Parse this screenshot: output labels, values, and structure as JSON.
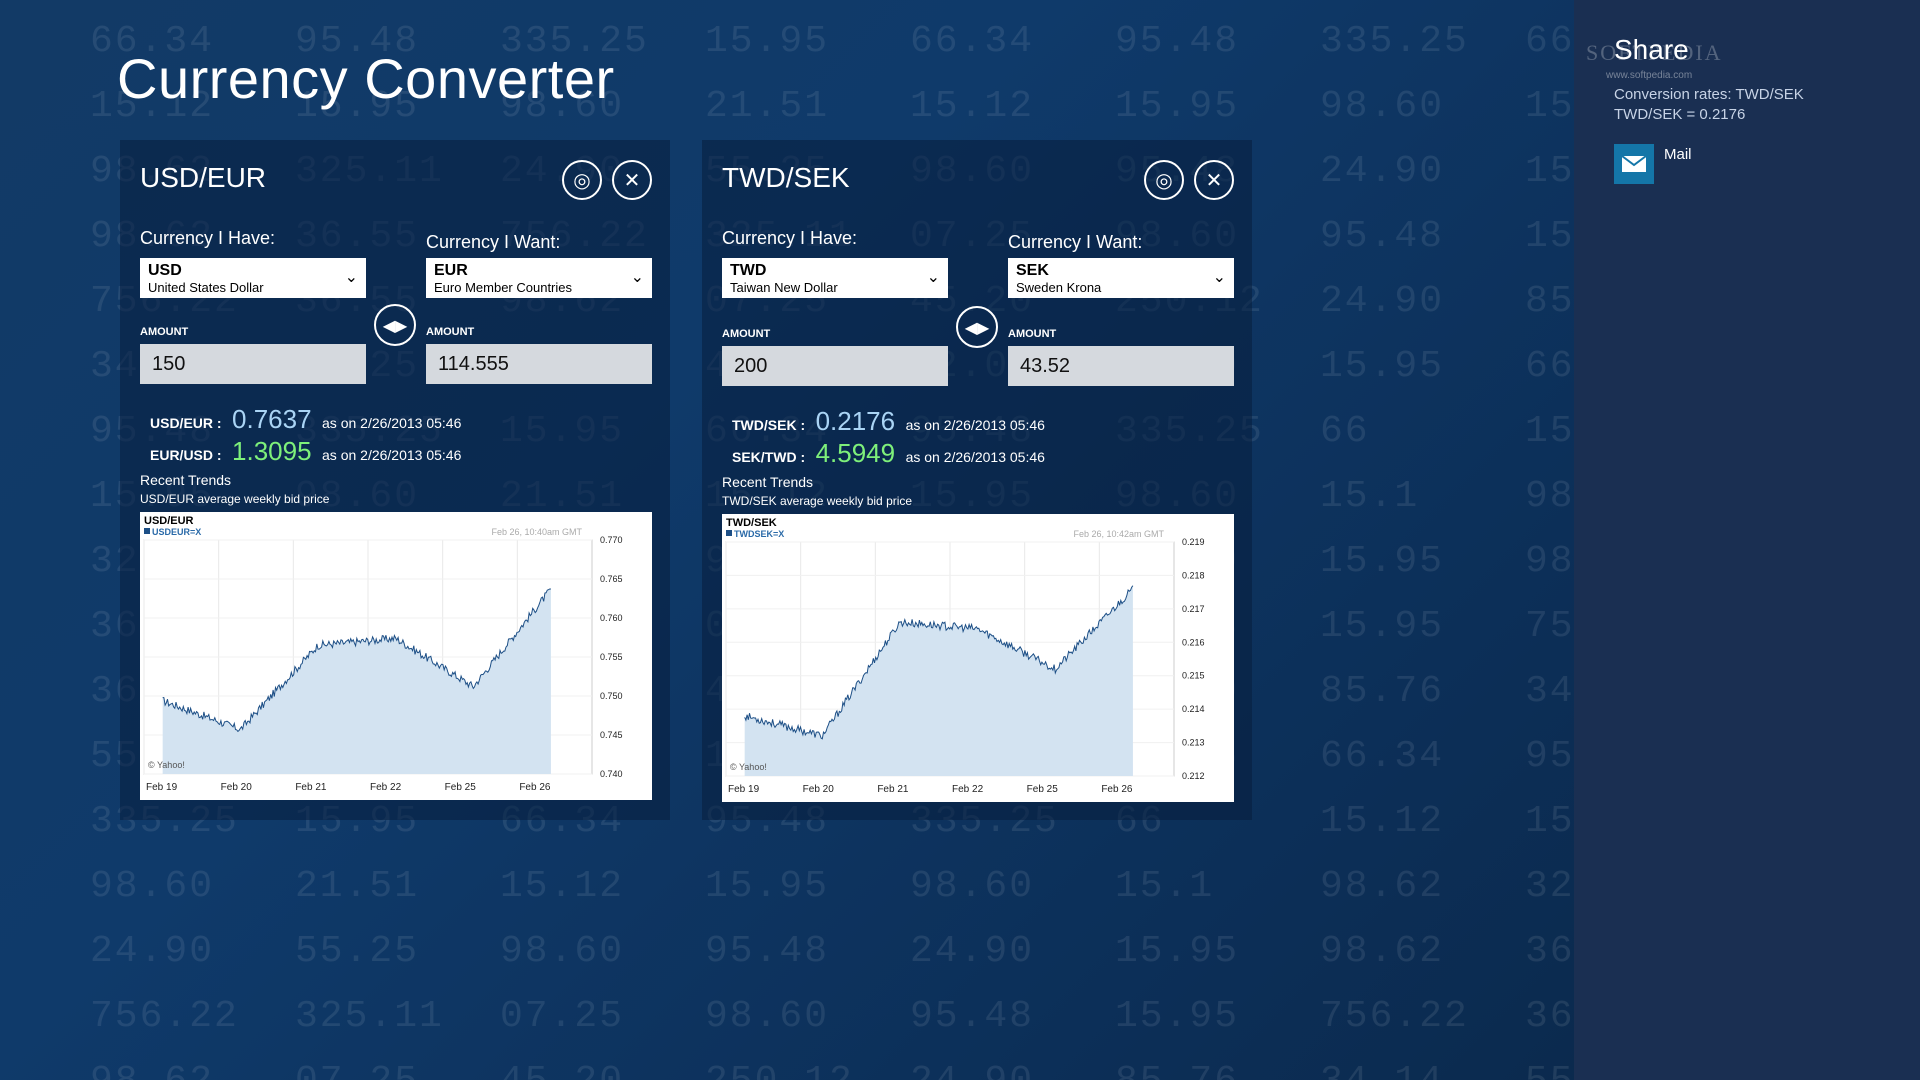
{
  "app": {
    "title": "Currency Converter"
  },
  "background_numbers": [
    "66.34",
    "95.48",
    "335.25",
    "15.95",
    "66.34",
    "95.48",
    "335.25",
    "66",
    "15.12",
    "15.95",
    "98.60",
    "21.51",
    "15.12",
    "15.95",
    "98.60",
    "15.1",
    "98.62",
    "325.11",
    "24.90",
    "55.25",
    "98.60",
    "95.48",
    "24.90",
    "15.95",
    "98.62",
    "36.55",
    "756.22",
    "325.11",
    "07.25",
    "98.60",
    "95.48",
    "15.95",
    "756.22",
    "36.55",
    "98.62",
    "07.25",
    "45.20",
    "250.12",
    "24.90",
    "85.76",
    "34.14",
    "55.25",
    "95.48",
    "47.20",
    "12.04",
    "98.60",
    "15.95"
  ],
  "panels": [
    {
      "pair_title": "USD/EUR",
      "have_label": "Currency I Have:",
      "want_label": "Currency I Want:",
      "have": {
        "code": "USD",
        "name": "United States Dollar"
      },
      "want": {
        "code": "EUR",
        "name": "Euro Member Countries"
      },
      "amount_label": "AMOUNT",
      "amount_have": "150",
      "amount_want": "114.555",
      "rate1": {
        "pair": "USD/EUR",
        "value": "0.7637",
        "asof": "as on  2/26/2013 05:46"
      },
      "rate2": {
        "pair": "EUR/USD",
        "value": "1.3095",
        "asof": "as on  2/26/2013 05:46"
      },
      "trends_title": "Recent Trends",
      "trends_sub": "USD/EUR average weekly bid price",
      "chart": {
        "title": "USD/EUR",
        "legend": "USDEUR=X",
        "timestamp": "Feb 26, 10:40am GMT",
        "credit": "© Yahoo!",
        "x_labels": [
          "Feb 19",
          "Feb 20",
          "Feb 21",
          "Feb 22",
          "Feb 25",
          "Feb 26"
        ],
        "y_labels": [
          "0.770",
          "0.765",
          "0.760",
          "0.755",
          "0.750",
          "0.745",
          "0.740"
        ]
      }
    },
    {
      "pair_title": "TWD/SEK",
      "have_label": "Currency I Have:",
      "want_label": "Currency I Want:",
      "have": {
        "code": "TWD",
        "name": "Taiwan New Dollar"
      },
      "want": {
        "code": "SEK",
        "name": "Sweden Krona"
      },
      "amount_label": "AMOUNT",
      "amount_have": "200",
      "amount_want": "43.52",
      "rate1": {
        "pair": "TWD/SEK",
        "value": "0.2176",
        "asof": "as on  2/26/2013 05:46"
      },
      "rate2": {
        "pair": "SEK/TWD",
        "value": "4.5949",
        "asof": "as on  2/26/2013 05:46"
      },
      "trends_title": "Recent Trends",
      "trends_sub": "TWD/SEK average weekly bid price",
      "chart": {
        "title": "TWD/SEK",
        "legend": "TWDSEK=X",
        "timestamp": "Feb 26, 10:42am GMT",
        "credit": "© Yahoo!",
        "x_labels": [
          "Feb 19",
          "Feb 20",
          "Feb 21",
          "Feb 22",
          "Feb 25",
          "Feb 26"
        ],
        "y_labels": [
          "0.219",
          "0.218",
          "0.217",
          "0.216",
          "0.215",
          "0.214",
          "0.213",
          "0.212"
        ]
      }
    }
  ],
  "chart_data": [
    {
      "type": "area",
      "title": "USD/EUR",
      "series": [
        {
          "name": "USDEUR=X",
          "x": [
            "Feb 19",
            "Feb 20",
            "Feb 21",
            "Feb 22",
            "Feb 25",
            "Feb 26"
          ],
          "values": [
            0.7494,
            0.7457,
            0.7565,
            0.7574,
            0.7512,
            0.7637
          ]
        }
      ],
      "ylim": [
        0.74,
        0.77
      ],
      "y_ticks": [
        0.74,
        0.745,
        0.75,
        0.755,
        0.76,
        0.765,
        0.77
      ],
      "line_color": "#1d4f86",
      "fill_color": "#d3e3f1"
    },
    {
      "type": "area",
      "title": "TWD/SEK",
      "series": [
        {
          "name": "TWDSEK=X",
          "x": [
            "Feb 19",
            "Feb 20",
            "Feb 21",
            "Feb 22",
            "Feb 25",
            "Feb 26"
          ],
          "values": [
            0.2138,
            0.2132,
            0.2166,
            0.2164,
            0.2152,
            0.2176
          ]
        }
      ],
      "ylim": [
        0.212,
        0.219
      ],
      "y_ticks": [
        0.212,
        0.213,
        0.214,
        0.215,
        0.216,
        0.217,
        0.218,
        0.219
      ],
      "line_color": "#1d4f86",
      "fill_color": "#d3e3f1"
    }
  ],
  "share": {
    "title": "Share",
    "line1": "Conversion rates: TWD/SEK",
    "line2": "TWD/SEK = 0.2176",
    "mail_label": "Mail",
    "watermark": "SOFTPEDIA",
    "watermark_url": "www.softpedia.com"
  },
  "icons": {
    "pin": "pin-icon",
    "close": "close-icon",
    "swap": "swap-icon",
    "chevron": "chevron-down-icon",
    "mail": "mail-icon"
  }
}
